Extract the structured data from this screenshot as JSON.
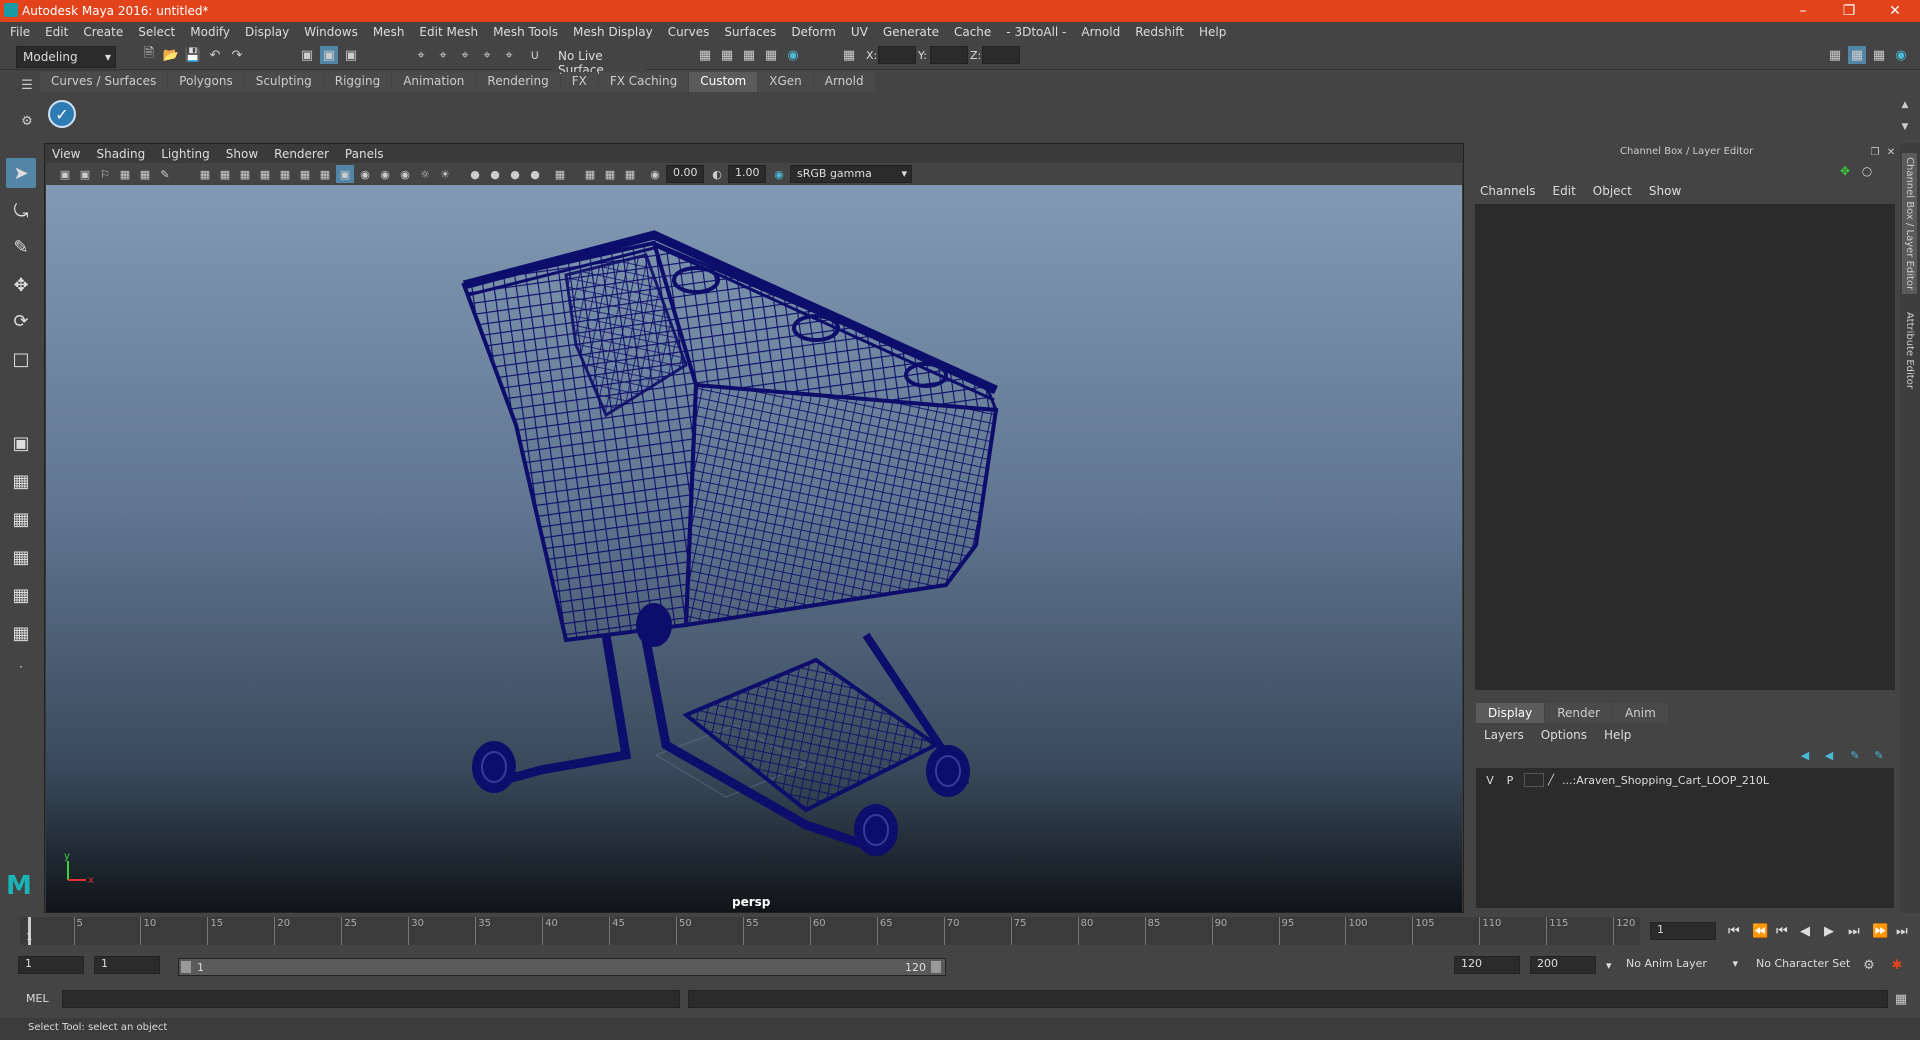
{
  "window": {
    "title": "Autodesk Maya 2016: untitled*"
  },
  "menubar": [
    "File",
    "Edit",
    "Create",
    "Select",
    "Modify",
    "Display",
    "Windows",
    "Mesh",
    "Edit Mesh",
    "Mesh Tools",
    "Mesh Display",
    "Curves",
    "Surfaces",
    "Deform",
    "UV",
    "Generate",
    "Cache",
    "- 3DtoAll -",
    "Arnold",
    "Redshift",
    "Help"
  ],
  "statusline": {
    "mode": "Modeling",
    "live_surface": "No Live Surface",
    "x_label": "X:",
    "y_label": "Y:",
    "z_label": "Z:"
  },
  "shelf_tabs": [
    "Curves / Surfaces",
    "Polygons",
    "Sculpting",
    "Rigging",
    "Animation",
    "Rendering",
    "FX",
    "FX Caching",
    "Custom",
    "XGen",
    "Arnold"
  ],
  "shelf_active": "Custom",
  "viewport": {
    "menu": [
      "View",
      "Shading",
      "Lighting",
      "Show",
      "Renderer",
      "Panels"
    ],
    "exposure": "0.00",
    "gamma": "1.00",
    "color_space": "sRGB gamma",
    "camera_label": "persp",
    "axis_y": "y",
    "axis_x": "x"
  },
  "channel_box": {
    "title": "Channel Box / Layer Editor",
    "menu": [
      "Channels",
      "Edit",
      "Object",
      "Show"
    ]
  },
  "layer_editor": {
    "tabs": [
      "Display",
      "Render",
      "Anim"
    ],
    "active_tab": "Display",
    "menu": [
      "Layers",
      "Options",
      "Help"
    ],
    "layer": {
      "v": "V",
      "p": "P",
      "name": "...:Araven_Shopping_Cart_LOOP_210L"
    }
  },
  "side_tabs": [
    "Channel Box / Layer Editor",
    "Attribute Editor"
  ],
  "timeline": {
    "ticks": [
      5,
      10,
      15,
      20,
      25,
      30,
      35,
      40,
      45,
      50,
      55,
      60,
      65,
      70,
      75,
      80,
      85,
      90,
      95,
      100,
      105,
      110,
      115,
      120
    ],
    "current_frame_marker": "1",
    "current_frame": "1"
  },
  "range": {
    "start": "1",
    "playback_start": "1",
    "bar_start": "1",
    "bar_end": "120",
    "playback_end": "120",
    "end": "200",
    "anim_layer": "No Anim Layer",
    "character_set": "No Character Set"
  },
  "cmdline": {
    "label": "MEL"
  },
  "helpline": {
    "text": "Select Tool: select an object"
  },
  "colors": {
    "title_bar": "#e2431a",
    "wireframe": "#0d0d6b",
    "active_tool": "#5285a6"
  }
}
